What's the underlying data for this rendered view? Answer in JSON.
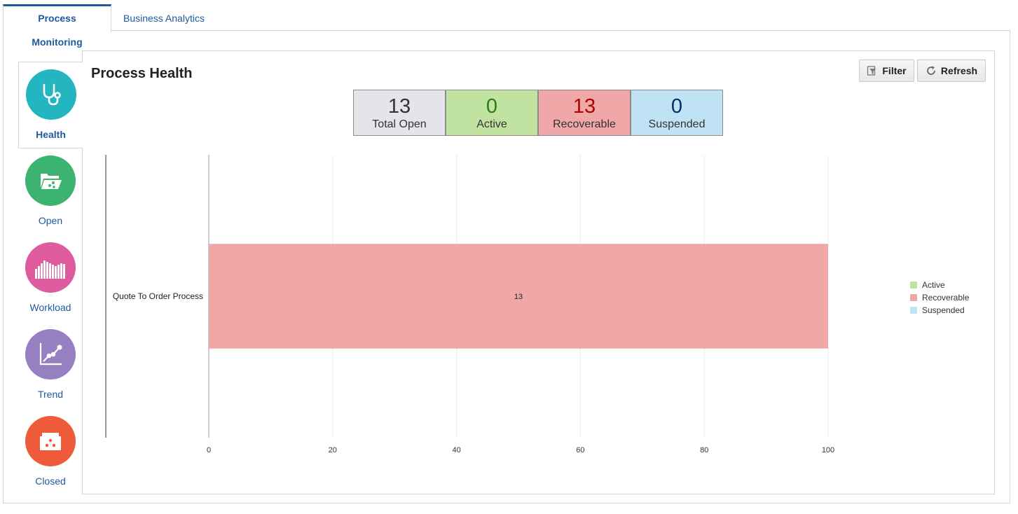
{
  "tabs": [
    {
      "label": "Process Monitoring",
      "active": true
    },
    {
      "label": "Business Analytics",
      "active": false
    }
  ],
  "nav": [
    {
      "label": "Health",
      "icon": "stethoscope-icon",
      "color": "#23b6c0",
      "selected": true
    },
    {
      "label": "Open",
      "icon": "open-folder-icon",
      "color": "#3cb371",
      "selected": false
    },
    {
      "label": "Workload",
      "icon": "bar-histogram-icon",
      "color": "#de5c9d",
      "selected": false
    },
    {
      "label": "Trend",
      "icon": "trend-line-icon",
      "color": "#9680c2",
      "selected": false
    },
    {
      "label": "Closed",
      "icon": "closed-box-icon",
      "color": "#ee5b3a",
      "selected": false
    }
  ],
  "panel": {
    "title": "Process Health",
    "filter_label": "Filter",
    "refresh_label": "Refresh"
  },
  "stats": [
    {
      "value": "13",
      "label": "Total Open",
      "bg": "#e3e5e8",
      "fg": "#333333"
    },
    {
      "value": "0",
      "label": "Active",
      "bg": "#c1e3a1",
      "fg": "#2e7a1a"
    },
    {
      "value": "13",
      "label": "Recoverable",
      "bg": "#efa7a7",
      "fg": "#b00000"
    },
    {
      "value": "0",
      "label": "Suspended",
      "bg": "#bfe3f4",
      "fg": "#0b2a6b"
    }
  ],
  "chart_data": {
    "type": "bar",
    "orientation": "horizontal",
    "stacked": true,
    "percent": true,
    "categories": [
      "Quote To Order Process"
    ],
    "series": [
      {
        "name": "Active",
        "values": [
          0
        ],
        "color": "#c1e3a1"
      },
      {
        "name": "Recoverable",
        "values": [
          100
        ],
        "label": "13",
        "color": "#efa7a7"
      },
      {
        "name": "Suspended",
        "values": [
          0
        ],
        "color": "#bfe3f4"
      }
    ],
    "xlim": [
      0,
      100
    ],
    "xticks": [
      "0",
      "20",
      "40",
      "60",
      "80",
      "100"
    ],
    "grid": true,
    "legend": "right"
  }
}
